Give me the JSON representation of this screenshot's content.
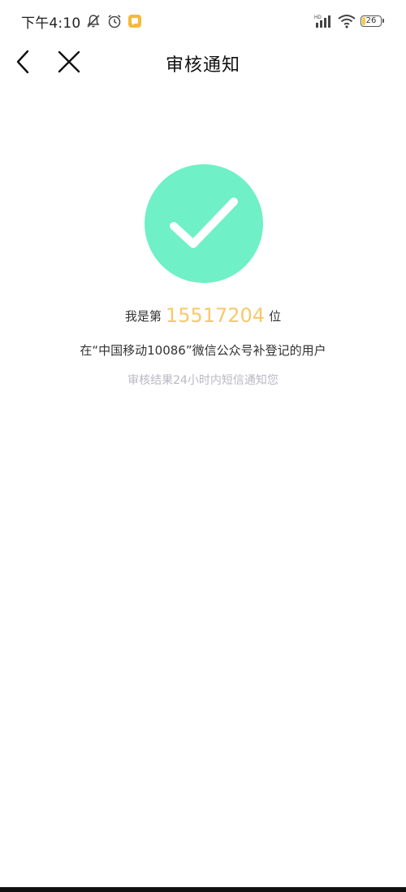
{
  "status_bar": {
    "time": "下午4:10",
    "network": "HD",
    "battery_level": "26",
    "icons": [
      "mute-bell-icon",
      "alarm-icon",
      "notification-app-icon",
      "signal-icon",
      "wifi-icon",
      "battery-icon"
    ],
    "battery_percent": 26
  },
  "nav": {
    "title": "审核通知",
    "back_icon": "chevron-left-icon",
    "close_icon": "close-icon"
  },
  "main": {
    "status_icon": "check-icon",
    "status_color": "#6ff0c6",
    "rank_prefix": "我是第",
    "rank_number": "15517204",
    "rank_suffix": "位",
    "rank_color": "#f7c96b",
    "description": "在“中国移动10086”微信公众号补登记的用户",
    "notice": "审核结果24小时内短信通知您"
  }
}
